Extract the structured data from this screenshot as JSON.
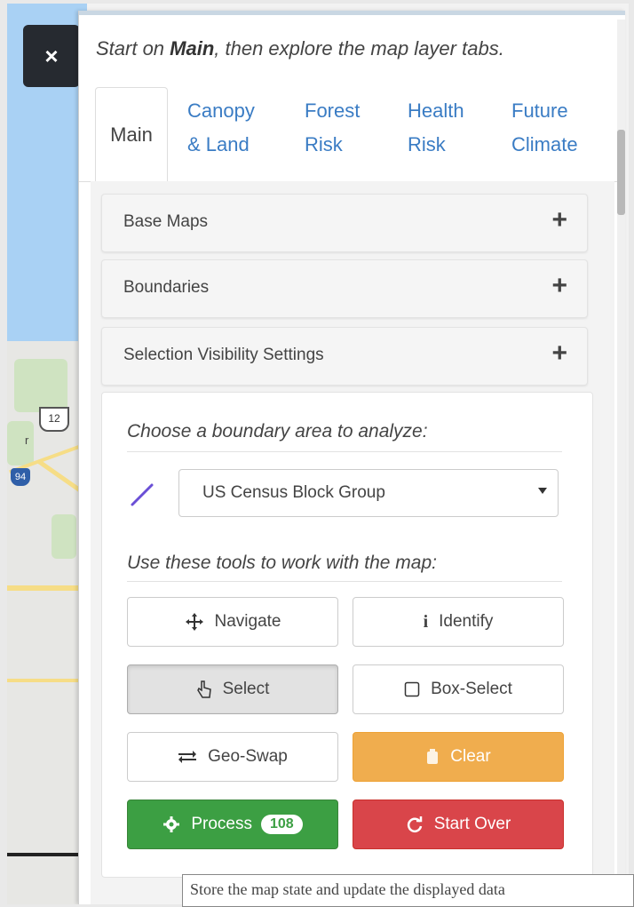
{
  "close_label": "×",
  "intro": {
    "prefix": "Start on ",
    "bold": "Main",
    "suffix": ", then explore the map layer tabs."
  },
  "tabs": [
    {
      "line1": "Main",
      "line2": ""
    },
    {
      "line1": "Canopy",
      "line2": "& Land"
    },
    {
      "line1": "Forest",
      "line2": "Risk"
    },
    {
      "line1": "Health",
      "line2": "Risk"
    },
    {
      "line1": "Future",
      "line2": "Climate"
    }
  ],
  "accordions": [
    {
      "label": "Base Maps",
      "icon": "plus-icon"
    },
    {
      "label": "Boundaries",
      "icon": "plus-icon"
    },
    {
      "label": "Selection Visibility Settings",
      "icon": "plus-icon"
    }
  ],
  "boundary_heading": "Choose a boundary area to analyze:",
  "boundary_select": {
    "value": "US Census Block Group"
  },
  "tools_heading": "Use these tools to work with the map:",
  "tools": {
    "navigate": "Navigate",
    "identify": "Identify",
    "select": "Select",
    "box_select": "Box-Select",
    "geo_swap": "Geo-Swap",
    "clear": "Clear",
    "process": "Process",
    "process_count": "108",
    "start_over": "Start Over"
  },
  "map": {
    "shield_12": "12",
    "shield_94": "94",
    "map_letter": "r"
  },
  "tooltip": "Store the map state and update the displayed data",
  "colors": {
    "warning": "#f0ad4e",
    "success": "#3c9f43",
    "danger": "#d9454a",
    "link": "#3a7cc4"
  }
}
